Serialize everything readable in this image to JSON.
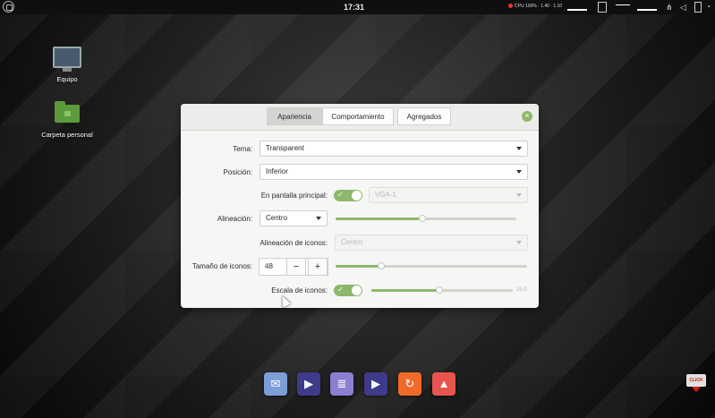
{
  "top_panel": {
    "clock": "17:31",
    "system_stats": "CPU 100% · 1.40 · 1.10"
  },
  "desktop": {
    "icons": [
      {
        "label": "Equipo",
        "icon": "computer-icon"
      },
      {
        "label": "Carpeta personal",
        "icon": "folder-icon"
      }
    ]
  },
  "dialog": {
    "tabs": [
      {
        "label": "Apariencia",
        "active": true
      },
      {
        "label": "Comportamiento",
        "active": false
      },
      {
        "label": "Agregados",
        "active": false
      }
    ],
    "rows": {
      "theme": {
        "label": "Tema:",
        "value": "Transparent"
      },
      "position": {
        "label": "Posición:",
        "value": "Inferior"
      },
      "main_screen": {
        "label": "En pantalla principal:",
        "enabled": true,
        "value": "VGA-1"
      },
      "alignment": {
        "label": "Alineación:",
        "value": "Centro",
        "slider_fraction": 0.48
      },
      "icon_alignment": {
        "label": "Alineación de iconos:",
        "value": "Centro"
      },
      "icon_size": {
        "label": "Tamaño de iconos:",
        "value": "48",
        "minus": "−",
        "plus": "+",
        "slider_fraction": 0.24
      },
      "icon_scale": {
        "label": "Escala de iconos:",
        "enabled": true,
        "value": "15.0",
        "slider_fraction": 0.48
      }
    }
  },
  "dock": {
    "apps": [
      {
        "name": "mail-app",
        "color": "#7c9ed6"
      },
      {
        "name": "media-player-app",
        "color": "#3f3a8a"
      },
      {
        "name": "text-editor-app",
        "color": "#8a7fd0"
      },
      {
        "name": "video-player-app",
        "color": "#3f3a8a"
      },
      {
        "name": "timeshift-app",
        "color": "#f06a2a"
      },
      {
        "name": "image-viewer-app",
        "color": "#e8554e"
      }
    ]
  },
  "badge": {
    "text": "CLICK"
  }
}
